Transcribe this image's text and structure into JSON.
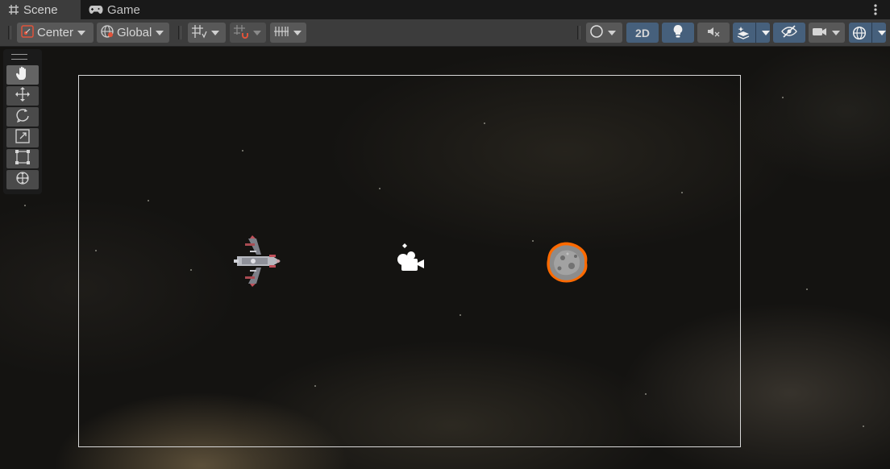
{
  "tabs": [
    {
      "label": "Scene",
      "icon": "hash-grid-icon",
      "active": true
    },
    {
      "label": "Game",
      "icon": "gamepad-icon",
      "active": false
    }
  ],
  "toolbar": {
    "pivot_mode": "Center",
    "pivot_rotation": "Global",
    "mode_2d": "2D"
  },
  "tools": [
    "hand-tool",
    "move-tool",
    "rotate-tool",
    "scale-tool",
    "rect-tool",
    "transform-tool"
  ],
  "scene_objects": [
    "player-ship",
    "main-camera",
    "asteroid"
  ],
  "colors": {
    "tab_bar": "#191919",
    "toolbar": "#3c3c3c",
    "button": "#585858",
    "button_active": "#46607c",
    "selection_outline": "#ff6a00"
  }
}
